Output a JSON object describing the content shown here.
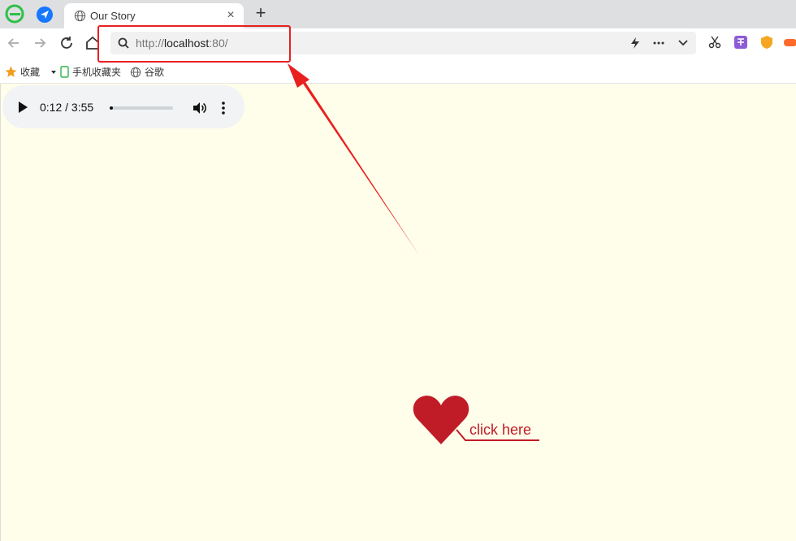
{
  "tab": {
    "title": "Our Story",
    "close_glyph": "×"
  },
  "new_tab_glyph": "+",
  "address": {
    "scheme": "http://",
    "host": "localhost",
    "port": ":80/"
  },
  "bookmarks": [
    {
      "label": "收藏",
      "icon": "star-icon"
    },
    {
      "label": "手机收藏夹",
      "icon": "phone-icon"
    },
    {
      "label": "谷歌",
      "icon": "globe-icon"
    }
  ],
  "audio": {
    "time": "0:12 / 3:55",
    "progress": 0.051
  },
  "link": {
    "label": "click here"
  },
  "colors": {
    "accent": "#c01c28",
    "annotation": "#e92020",
    "page_bg": "#fffeea"
  }
}
